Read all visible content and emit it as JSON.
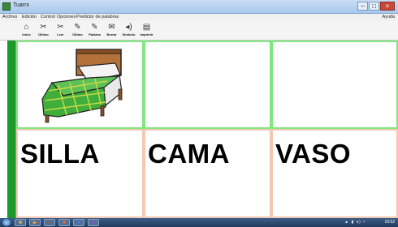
{
  "window": {
    "title": "Tuarrx"
  },
  "menu": {
    "items": [
      "Archivo",
      "Edición",
      "Control",
      "Opciones",
      "Predictor de palabras"
    ],
    "help": "Ayuda"
  },
  "toolbar": {
    "tools": [
      {
        "label": "Inicio",
        "icon": "home-icon",
        "glyph": "⌂"
      },
      {
        "label": "Último",
        "icon": "back-icon",
        "glyph": "✂"
      },
      {
        "label": "Leer",
        "icon": "read-icon",
        "glyph": "✂"
      },
      {
        "label": "Último",
        "icon": "pencil-icon",
        "glyph": "✎"
      },
      {
        "label": "Palabra",
        "icon": "pencil-word-icon",
        "glyph": "✎"
      },
      {
        "label": "Borrar",
        "icon": "eraser-icon",
        "glyph": "✉"
      },
      {
        "label": "Símbolo",
        "icon": "speaker-icon",
        "glyph": "◂)"
      },
      {
        "label": "Imprimir",
        "icon": "printer-icon",
        "glyph": "▤"
      }
    ]
  },
  "board": {
    "cells": [
      {
        "row": 0,
        "content": "image",
        "picture": "bed-picture"
      },
      {
        "row": 0,
        "content": "empty"
      },
      {
        "row": 0,
        "content": "empty"
      },
      {
        "row": 1,
        "word": "SILLA"
      },
      {
        "row": 1,
        "word": "CAMA"
      },
      {
        "row": 1,
        "word": "VASO"
      }
    ]
  },
  "taskbar": {
    "apps": [
      "folder-icon",
      "media-player-icon",
      "chrome-icon",
      "paint-icon",
      "word-icon",
      "app-icon"
    ],
    "clock": "19:52",
    "colors": {
      "accent": "#1b9a2b"
    }
  }
}
